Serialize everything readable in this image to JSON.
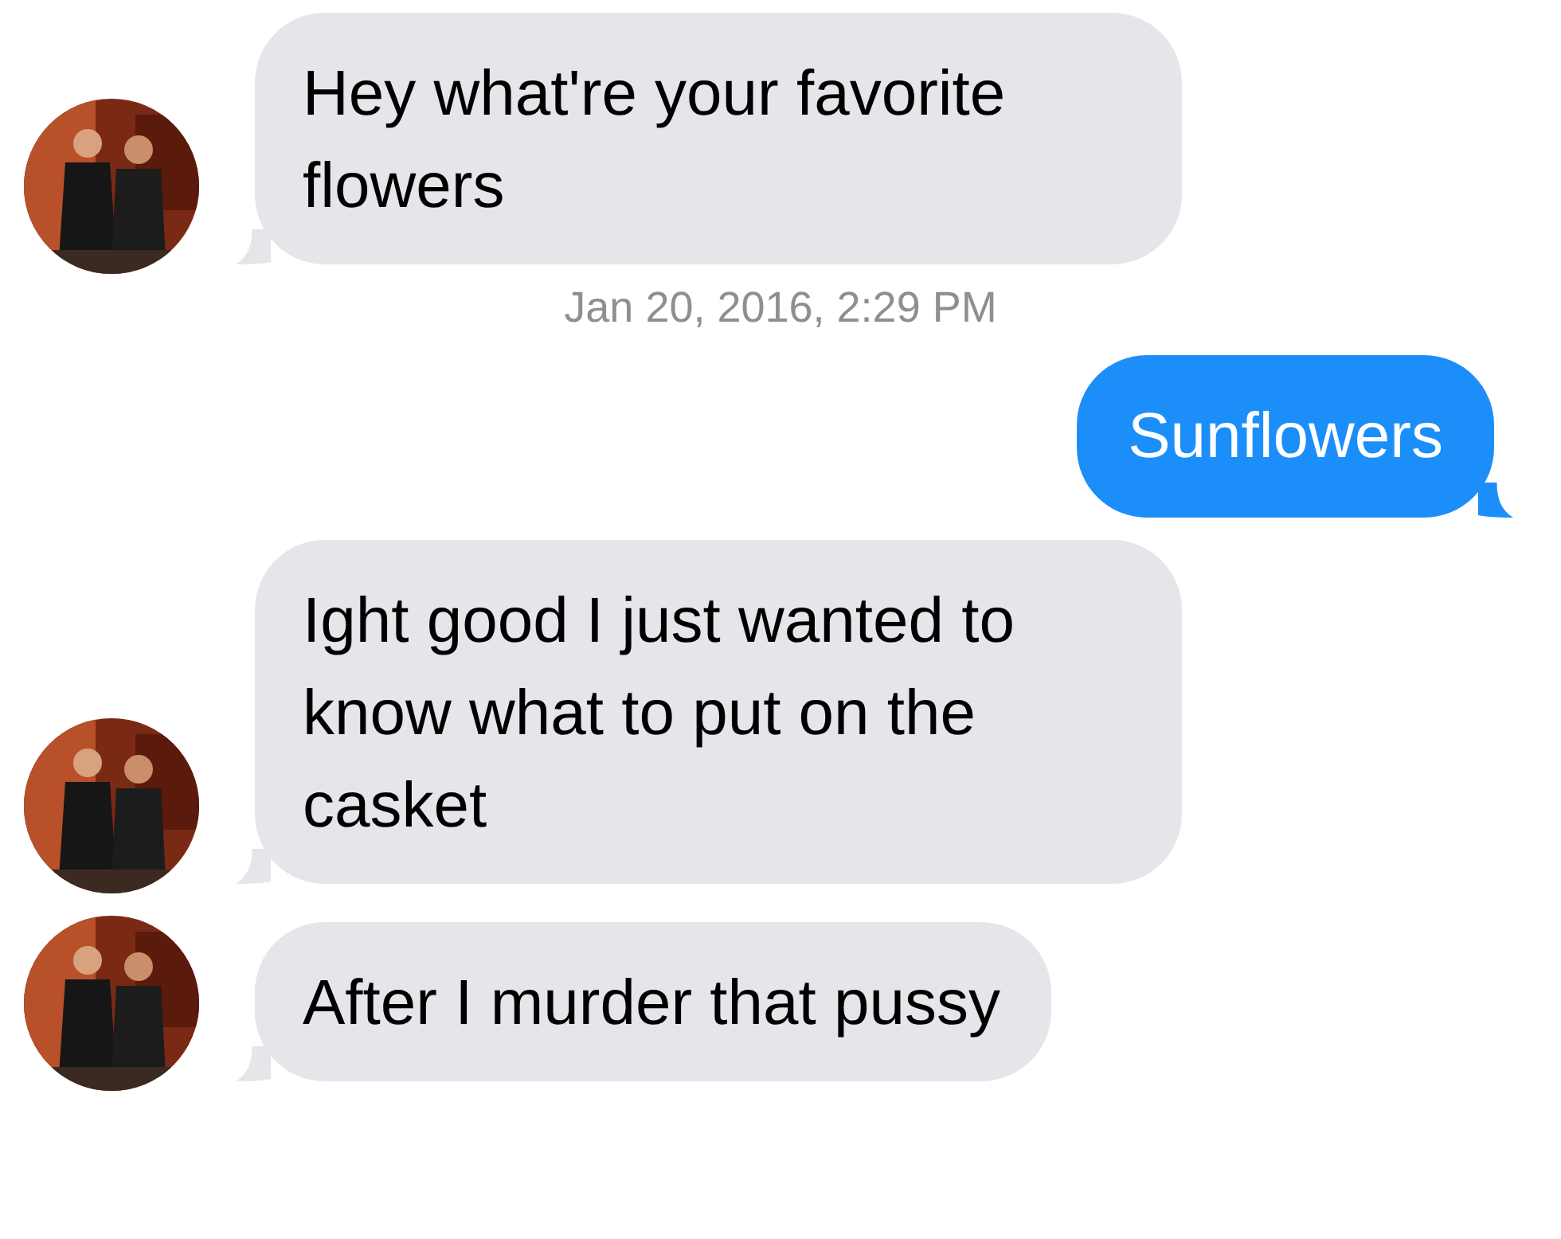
{
  "messages": [
    {
      "kind": "incoming",
      "text": "Hey what're your favorite flowers"
    },
    {
      "kind": "timestamp",
      "text": "Jan 20, 2016, 2:29 PM"
    },
    {
      "kind": "outgoing",
      "text": "Sunflowers"
    },
    {
      "kind": "incoming",
      "text": "Ight good I just wanted to know what to put on the casket"
    },
    {
      "kind": "incoming",
      "text": "After I murder that pussy"
    }
  ]
}
